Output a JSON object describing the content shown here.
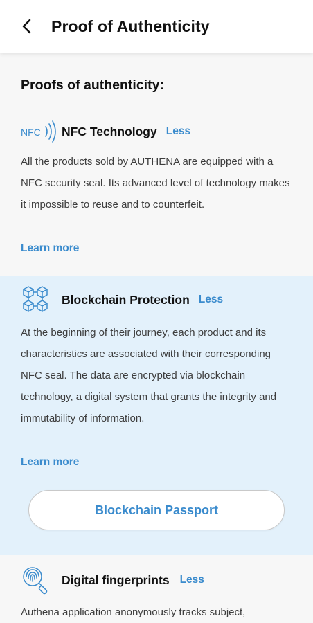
{
  "header": {
    "title": "Proof of Authenticity",
    "back_icon": "chevron-left-icon"
  },
  "section": {
    "heading": "Proofs of authenticity:"
  },
  "cards": [
    {
      "icon": "nfc-icon",
      "icon_text": "NFC",
      "title": "NFC Technology",
      "toggle": "Less",
      "body": "All the products sold by AUTHENA are equipped with a NFC security seal. Its advanced level of technology makes it impossible to reuse and to counterfeit.",
      "learn_more": "Learn more"
    },
    {
      "icon": "blockchain-icon",
      "title": "Blockchain Protection",
      "toggle": "Less",
      "body": "At the beginning of their journey, each product and its characteristics are associated with their corresponding NFC seal. The data are encrypted via blockchain technology, a digital system that grants the integrity and immutability of information.",
      "learn_more": "Learn more",
      "button": "Blockchain Passport",
      "highlighted": true
    },
    {
      "icon": "fingerprint-search-icon",
      "title": "Digital fingerprints",
      "toggle": "Less",
      "body": "Authena application anonymously tracks subject,"
    }
  ],
  "colors": {
    "accent": "#3a8bcd",
    "highlight_bg": "#e3f1fb",
    "page_bg": "#f7f7f7",
    "text": "#3d3d3d"
  }
}
